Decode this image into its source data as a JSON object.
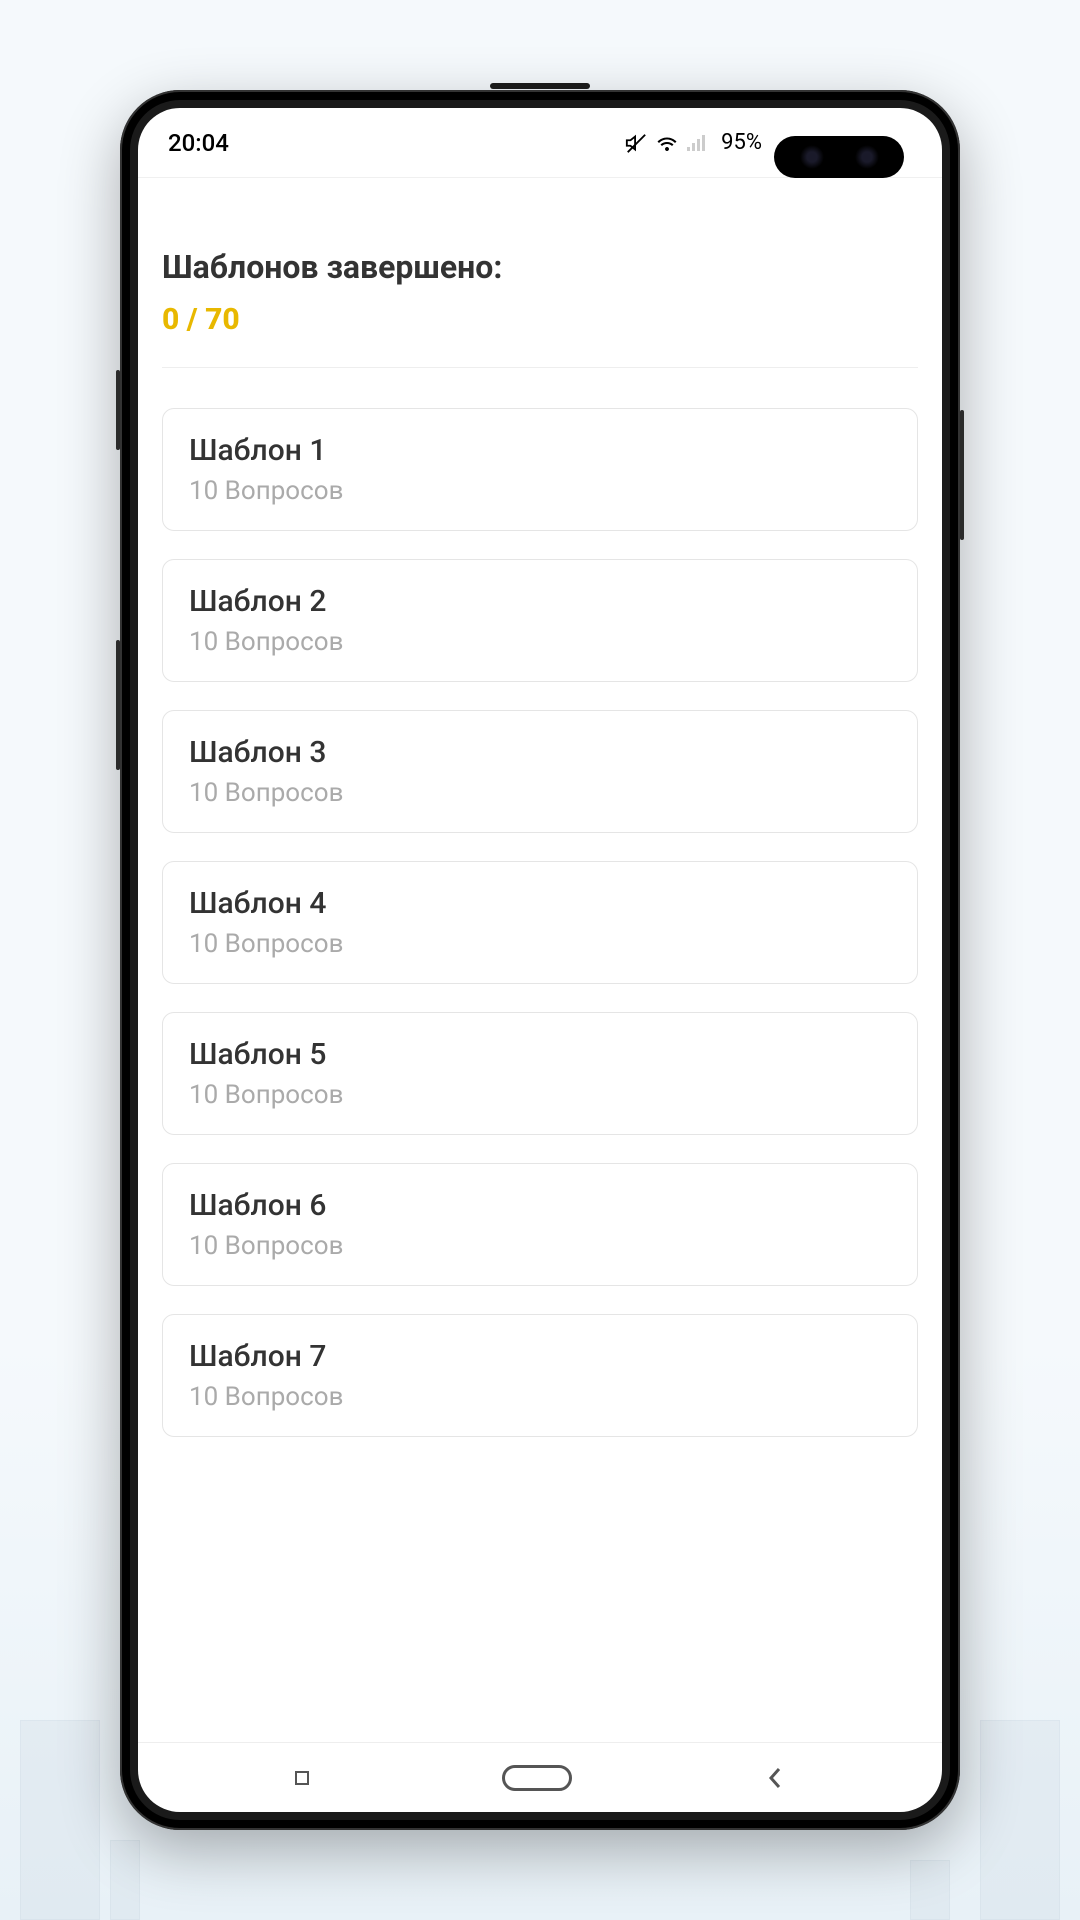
{
  "statusBar": {
    "time": "20:04",
    "batteryPercent": "95%"
  },
  "header": {
    "title": "Шаблонов завершено:",
    "counter": "0 / 70"
  },
  "templates": [
    {
      "title": "Шаблон 1",
      "subtitle": "10 Вопросов"
    },
    {
      "title": "Шаблон 2",
      "subtitle": "10 Вопросов"
    },
    {
      "title": "Шаблон 3",
      "subtitle": "10 Вопросов"
    },
    {
      "title": "Шаблон 4",
      "subtitle": "10 Вопросов"
    },
    {
      "title": "Шаблон 5",
      "subtitle": "10 Вопросов"
    },
    {
      "title": "Шаблон 6",
      "subtitle": "10 Вопросов"
    },
    {
      "title": "Шаблон 7",
      "subtitle": "10 Вопросов"
    }
  ]
}
